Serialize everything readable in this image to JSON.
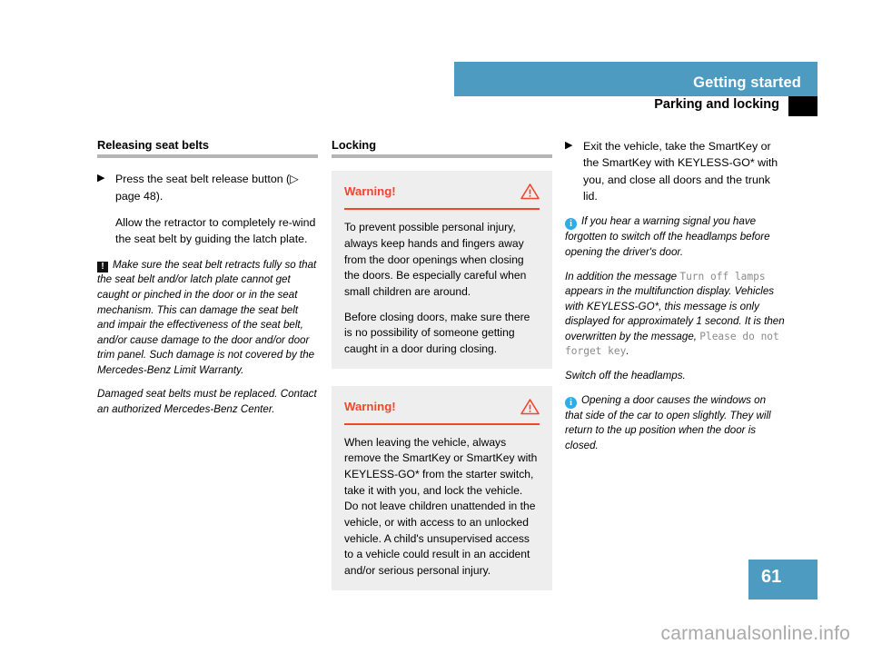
{
  "header": {
    "chapter_title": "Getting started",
    "section_title": "Parking and locking",
    "bar_color": "#4d9bc0",
    "thumb_tab_color": "#000000"
  },
  "page": {
    "number": "61",
    "number_box_color": "#4d9bc0",
    "watermark": "carmanualsonline.info"
  },
  "icons": {
    "bullet_arrow": "▶",
    "cross_ref_arrow": "▷",
    "exclamation": "!",
    "info": "i",
    "warning_triangle": "warning-triangle-icon"
  },
  "left_column": {
    "heading": "Releasing seat belts",
    "bullet_1": {
      "marker": "▶",
      "text_before_ref": "Press the seat belt release button (",
      "ref_arrow": "▷",
      "ref_text": " page 48).",
      "full_text": "Press the seat belt release button (▷ page 48)."
    },
    "paragraph_1": "Allow the retractor to completely re-wind the seat belt by guiding the latch plate.",
    "note_1": "Make sure the seat belt retracts fully so that the seat belt and/or latch plate cannot get caught or pinched in the door or in the seat mechanism. This can damage the seat belt and impair the effectiveness of the seat belt, and/or cause damage to the door and/or door trim panel. Such damage is not covered by the Mercedes-Benz Limit Warranty.",
    "note_2": "Damaged seat belts must be replaced. Contact an authorized Mercedes-Benz Center."
  },
  "middle_column": {
    "heading": "Locking",
    "warning_boxes": [
      {
        "title": "Warning!",
        "accent_color": "#f4442e",
        "background_color": "#eeeeee",
        "paragraphs": [
          "To prevent possible personal injury, always keep hands and fingers away from the door openings when closing the doors. Be especially careful when small children are around.",
          "Before closing doors, make sure there is no possibility of someone getting caught in a door during closing."
        ]
      },
      {
        "title": "Warning!",
        "accent_color": "#f4442e",
        "background_color": "#eeeeee",
        "paragraphs": [
          "When leaving the vehicle, always remove the SmartKey or SmartKey with KEYLESS-GO* from the starter switch, take it with you, and lock the vehicle. Do not leave children unattended in the vehicle, or with access to an unlocked vehicle. A child's unsupervised access to a vehicle could result in an accident and/or serious personal injury."
        ]
      }
    ]
  },
  "right_column": {
    "bullet_1": {
      "marker": "▶",
      "text": "Exit the vehicle, take the SmartKey or the SmartKey with KEYLESS-GO* with you, and close all doors and the trunk lid."
    },
    "note_1": "If you hear a warning signal you have forgotten to switch off the headlamps before opening the driver's door.",
    "note_2_part1": "In addition the message ",
    "note_2_mono1": "Turn off lamps",
    "note_2_part2": " appears in the multifunction display. Vehicles with KEYLESS-GO*, this message is only displayed for approximately 1 second. It is then overwritten by the message, ",
    "note_2_mono2": "Please do not forget key",
    "note_2_part3": ".",
    "note_3": "Switch off the headlamps.",
    "note_4": "Opening a door causes the windows on that side of the car to open slightly. They will return to the up position when the door is closed."
  }
}
